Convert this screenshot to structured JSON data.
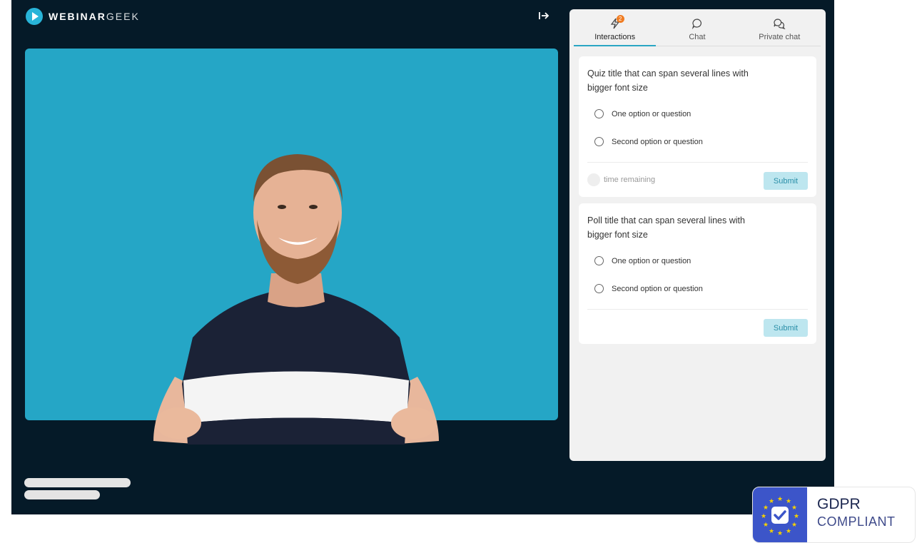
{
  "brand": {
    "name_bold": "WEBINAR",
    "name_light": "GEEK"
  },
  "header": {
    "collapse_icon": "arrow-right-to-bar-icon"
  },
  "tabs": [
    {
      "label": "Interactions",
      "icon": "lightning-icon",
      "badge": "2",
      "active": true
    },
    {
      "label": "Chat",
      "icon": "chat-bubble-icon",
      "active": false
    },
    {
      "label": "Private chat",
      "icon": "private-chat-icon",
      "active": false
    }
  ],
  "quiz": {
    "title": "Quiz title that can span several lines with bigger font size",
    "options": [
      "One option or question",
      "Second option or question"
    ],
    "timer_text": "time remaining",
    "submit_label": "Submit"
  },
  "poll": {
    "title": "Poll title that can span several lines with bigger font size",
    "options": [
      "One option or question",
      "Second option or question"
    ],
    "submit_label": "Submit"
  },
  "gdpr": {
    "title": "GDPR",
    "subtitle": "COMPLIANT"
  },
  "colors": {
    "background": "#051a28",
    "video": "#25a6c6",
    "accent": "#2aa6c4",
    "badge": "#f07c22",
    "gdpr_blue": "#3c55c9"
  }
}
